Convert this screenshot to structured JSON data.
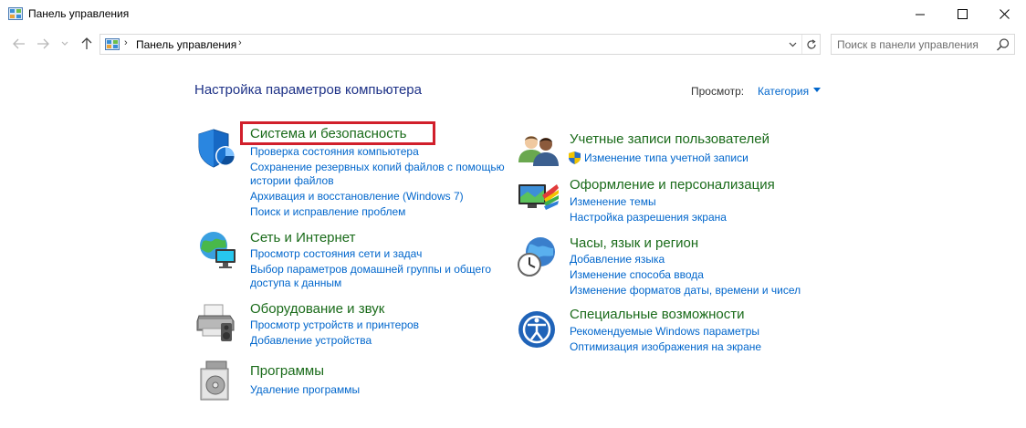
{
  "window": {
    "title": "Панель управления"
  },
  "address": {
    "crumb": "Панель управления",
    "search_placeholder": "Поиск в панели управления"
  },
  "main": {
    "title": "Настройка параметров компьютера",
    "view_label": "Просмотр:",
    "view_value": "Категория"
  },
  "categories_left": [
    {
      "title": "Система и безопасность",
      "icon": "shield-icon",
      "links": [
        "Проверка состояния компьютера",
        "Сохранение резервных копий файлов с помощью",
        "истории файлов",
        "Архивация и восстановление (Windows 7)",
        "Поиск и исправление проблем"
      ]
    },
    {
      "title": "Сеть и Интернет",
      "icon": "network-globe-icon",
      "links": [
        "Просмотр состояния сети и задач",
        "Выбор параметров домашней группы и общего",
        "доступа к данным"
      ]
    },
    {
      "title": "Оборудование и звук",
      "icon": "printer-icon",
      "links": [
        "Просмотр устройств и принтеров",
        "Добавление устройства"
      ]
    },
    {
      "title": "Программы",
      "icon": "programs-disc-icon",
      "links": [
        "Удаление программы"
      ]
    }
  ],
  "categories_right": [
    {
      "title": "Учетные записи пользователей",
      "icon": "users-icon",
      "links": [
        "Изменение типа учетной записи"
      ]
    },
    {
      "title": "Оформление и персонализация",
      "icon": "personalization-monitor-icon",
      "links": [
        "Изменение темы",
        "Настройка разрешения экрана"
      ]
    },
    {
      "title": "Часы, язык и регион",
      "icon": "clock-globe-icon",
      "links": [
        "Добавление языка",
        "Изменение способа ввода",
        "Изменение форматов даты, времени и чисел"
      ]
    },
    {
      "title": "Специальные возможности",
      "icon": "accessibility-icon",
      "links": [
        "Рекомендуемые Windows параметры",
        "Оптимизация изображения на экране"
      ]
    }
  ],
  "colors": {
    "category_title": "#1a6b1a",
    "link": "#0066cc",
    "page_title": "#1e3287",
    "highlight": "#d11f2b"
  }
}
